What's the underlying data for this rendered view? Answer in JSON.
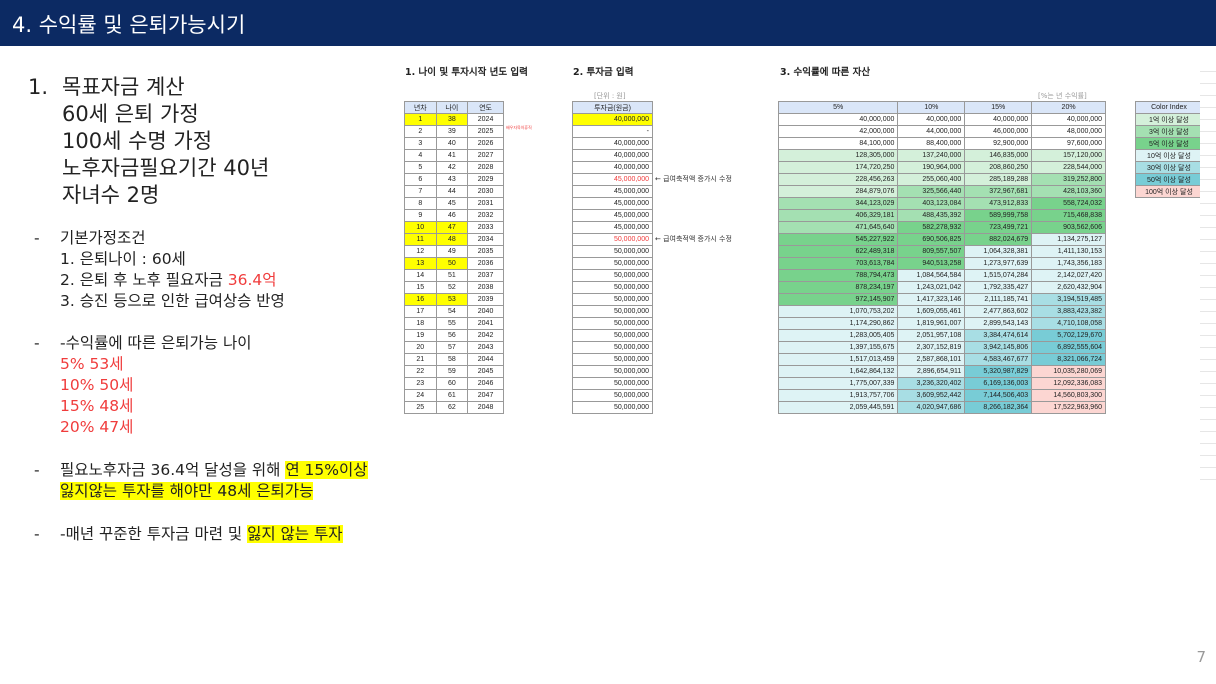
{
  "header": {
    "title": "4. 수익률 및 은퇴가능시기"
  },
  "goal": {
    "num": "1.",
    "lines": [
      "목표자금 계산",
      "60세 은퇴 가정",
      "100세 수명 가정",
      "노후자금필요기간 40년",
      "자녀수 2명"
    ]
  },
  "assumptions": {
    "dash": "-",
    "title": "기본가정조건",
    "l1": "1. 은퇴나이 : 60세",
    "l2_pre": "2. 은퇴 후 노후 필요자금 ",
    "l2_red": "36.4억",
    "l3": "3. 승진 등으로 인한 급여상승 반영"
  },
  "retire": {
    "dash": "-",
    "title": "-수익률에 따른 은퇴가능 나이",
    "items": [
      "5% 53세",
      "10% 50세",
      "15% 48세",
      "20% 47세"
    ]
  },
  "goalnote": {
    "dash": "-",
    "pre": "필요노후자금 36.4억 달성을 위해 ",
    "hl1": "연 15%이상",
    "hl2": "잃지않는 투자를 해야만 48세 은퇴가능"
  },
  "final": {
    "dash": "-",
    "pre": "-매년 꾸준한 투자금 마련 및 ",
    "hl": "잃지 않는 투자"
  },
  "sections": {
    "s1": "1. 나이 및 투자시작 년도 입력",
    "s2": "2. 투자금 입력",
    "s3": "3. 수익률에 따른 자산",
    "unit2": "[단위 : 원]",
    "unit3": "[%는 년 수익률]",
    "tiny_note": "배우자육아휴직",
    "raise_note": "← 급여축적액 증가시 수정"
  },
  "t1": {
    "headers": [
      "년차",
      "나이",
      "연도"
    ],
    "rows": [
      [
        1,
        38,
        2024
      ],
      [
        2,
        39,
        2025
      ],
      [
        3,
        40,
        2026
      ],
      [
        4,
        41,
        2027
      ],
      [
        5,
        42,
        2028
      ],
      [
        6,
        43,
        2029
      ],
      [
        7,
        44,
        2030
      ],
      [
        8,
        45,
        2031
      ],
      [
        9,
        46,
        2032
      ],
      [
        10,
        47,
        2033
      ],
      [
        11,
        48,
        2034
      ],
      [
        12,
        49,
        2035
      ],
      [
        13,
        50,
        2036
      ],
      [
        14,
        51,
        2037
      ],
      [
        15,
        52,
        2038
      ],
      [
        16,
        53,
        2039
      ],
      [
        17,
        54,
        2040
      ],
      [
        18,
        55,
        2041
      ],
      [
        19,
        56,
        2042
      ],
      [
        20,
        57,
        2043
      ],
      [
        21,
        58,
        2044
      ],
      [
        22,
        59,
        2045
      ],
      [
        23,
        60,
        2046
      ],
      [
        24,
        61,
        2047
      ],
      [
        25,
        62,
        2048
      ]
    ],
    "highlight_years": [
      1,
      10,
      11,
      13,
      16
    ]
  },
  "t2": {
    "header": "투자금(원금)",
    "values": [
      "40,000,000",
      "-",
      "40,000,000",
      "40,000,000",
      "40,000,000",
      "45,000,000",
      "45,000,000",
      "45,000,000",
      "45,000,000",
      "45,000,000",
      "50,000,000",
      "50,000,000",
      "50,000,000",
      "50,000,000",
      "50,000,000",
      "50,000,000",
      "50,000,000",
      "50,000,000",
      "50,000,000",
      "50,000,000",
      "50,000,000",
      "50,000,000",
      "50,000,000",
      "50,000,000",
      "50,000,000"
    ],
    "red_rows": [
      5,
      10
    ]
  },
  "t3": {
    "headers": [
      "5%",
      "10%",
      "15%",
      "20%"
    ],
    "rows": [
      [
        "40,000,000",
        "40,000,000",
        "40,000,000",
        "40,000,000"
      ],
      [
        "42,000,000",
        "44,000,000",
        "46,000,000",
        "48,000,000"
      ],
      [
        "84,100,000",
        "88,400,000",
        "92,900,000",
        "97,600,000"
      ],
      [
        "128,305,000",
        "137,240,000",
        "146,835,000",
        "157,120,000"
      ],
      [
        "174,720,250",
        "190,964,000",
        "208,860,250",
        "228,544,000"
      ],
      [
        "228,456,263",
        "255,060,400",
        "285,189,288",
        "319,252,800"
      ],
      [
        "284,879,076",
        "325,566,440",
        "372,967,681",
        "428,103,360"
      ],
      [
        "344,123,029",
        "403,123,084",
        "473,912,833",
        "558,724,032"
      ],
      [
        "406,329,181",
        "488,435,392",
        "589,999,758",
        "715,468,838"
      ],
      [
        "471,645,640",
        "582,278,932",
        "723,499,721",
        "903,562,606"
      ],
      [
        "545,227,922",
        "690,506,825",
        "882,024,679",
        "1,134,275,127"
      ],
      [
        "622,489,318",
        "809,557,507",
        "1,064,328,381",
        "1,411,130,153"
      ],
      [
        "703,613,784",
        "940,513,258",
        "1,273,977,639",
        "1,743,356,183"
      ],
      [
        "788,794,473",
        "1,084,564,584",
        "1,515,074,284",
        "2,142,027,420"
      ],
      [
        "878,234,197",
        "1,243,021,042",
        "1,792,335,427",
        "2,620,432,904"
      ],
      [
        "972,145,907",
        "1,417,323,146",
        "2,111,185,741",
        "3,194,519,485"
      ],
      [
        "1,070,753,202",
        "1,609,055,461",
        "2,477,863,602",
        "3,883,423,382"
      ],
      [
        "1,174,290,862",
        "1,819,961,007",
        "2,899,543,143",
        "4,710,108,058"
      ],
      [
        "1,283,005,405",
        "2,051,957,108",
        "3,384,474,614",
        "5,702,129,670"
      ],
      [
        "1,397,155,675",
        "2,307,152,819",
        "3,942,145,806",
        "6,892,555,604"
      ],
      [
        "1,517,013,459",
        "2,587,868,101",
        "4,583,467,677",
        "8,321,066,724"
      ],
      [
        "1,642,864,132",
        "2,896,654,911",
        "5,320,987,829",
        "10,035,280,069"
      ],
      [
        "1,775,007,339",
        "3,236,320,402",
        "6,169,136,003",
        "12,092,336,083"
      ],
      [
        "1,913,757,706",
        "3,609,952,442",
        "7,144,506,403",
        "14,560,803,300"
      ],
      [
        "2,059,445,591",
        "4,020,947,686",
        "8,266,182,364",
        "17,522,963,960"
      ]
    ]
  },
  "color_index": {
    "header": "Color Index",
    "items": [
      {
        "label": "1억 이상 달성",
        "color": "#d4f0da"
      },
      {
        "label": "3억 이상 달성",
        "color": "#a4e0b2"
      },
      {
        "label": "5억 이상 달성",
        "color": "#78d28c"
      },
      {
        "label": "10억 이상 달성",
        "color": "#def3f5"
      },
      {
        "label": "30억 이상 달성",
        "color": "#a8dee4"
      },
      {
        "label": "50억 이상 달성",
        "color": "#78ccd6"
      },
      {
        "label": "100억 이상 달성",
        "color": "#fcd6d2"
      }
    ]
  },
  "page_number": "7"
}
